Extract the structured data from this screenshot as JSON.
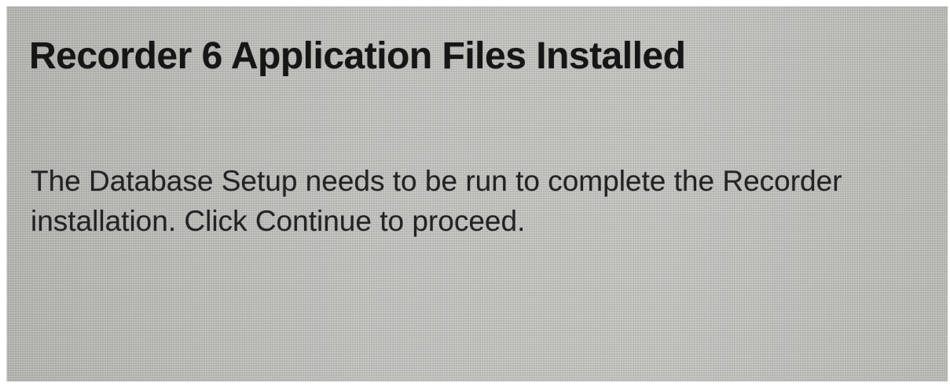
{
  "dialog": {
    "title": "Recorder 6 Application Files Installed",
    "message_lines": [
      "The Database Setup needs to be run to complete the Recorder",
      "installation.  Click Continue to proceed."
    ]
  },
  "colors": {
    "panel_background": "#c3c3bf",
    "title_text": "#161616",
    "body_text": "#232323"
  }
}
